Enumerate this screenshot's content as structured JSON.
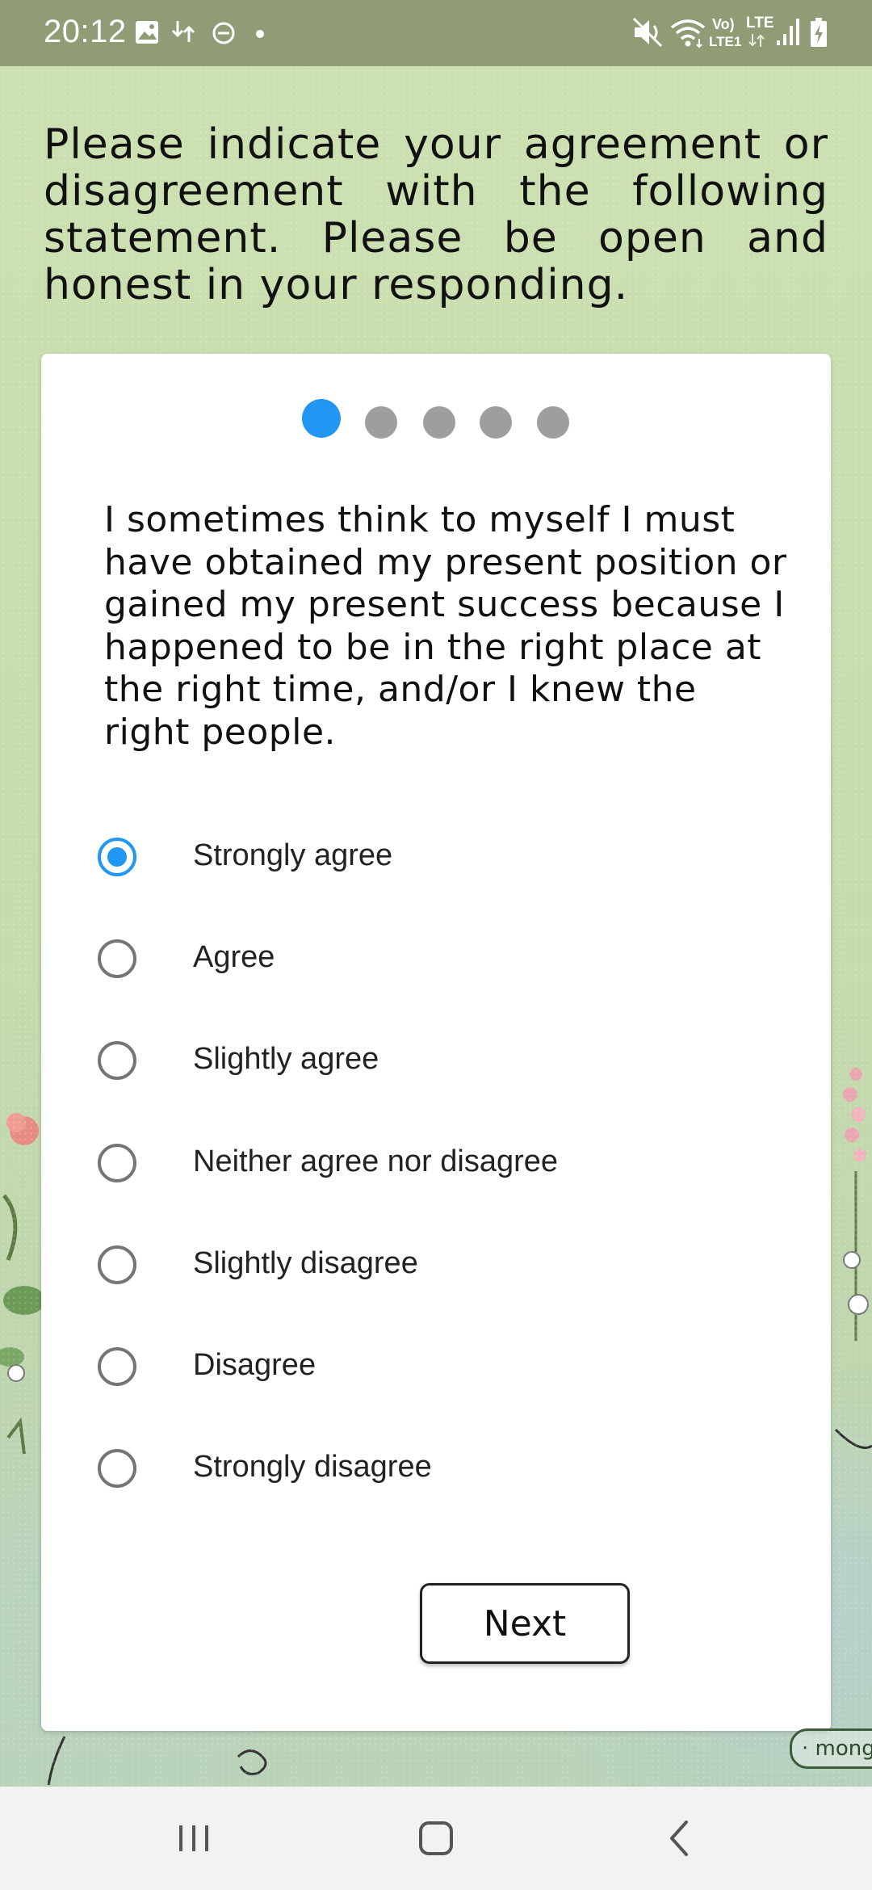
{
  "status_bar": {
    "time": "20:12",
    "left_icons": [
      "gallery-icon",
      "transfer-icon",
      "do-not-disturb-icon",
      "notification-dot-icon"
    ],
    "right_icons": [
      "mute-icon",
      "wifi-icon",
      "volte-lte1-icon",
      "lte-icon",
      "signal-icon",
      "battery-charging-icon"
    ],
    "volte_text": "Vo)",
    "lte1_text": "LTE1",
    "lte_text": "LTE"
  },
  "instruction": "Please indicate your agreement or disagreement with the following statement. Please be open and honest in your responding.",
  "progress": {
    "total_steps": 5,
    "current_step": 1
  },
  "statement": "I sometimes think to myself I must have obtained my present position or gained my present success because I happened to be in the right place at the right time, and/or I knew the right people.",
  "options": [
    {
      "label": "Strongly agree",
      "selected": true
    },
    {
      "label": "Agree",
      "selected": false
    },
    {
      "label": "Slightly agree",
      "selected": false
    },
    {
      "label": "Neither agree nor disagree",
      "selected": false
    },
    {
      "label": "Slightly disagree",
      "selected": false
    },
    {
      "label": "Disagree",
      "selected": false
    },
    {
      "label": "Strongly disagree",
      "selected": false
    }
  ],
  "next_button": "Next",
  "watermark": "· mongd",
  "nav_bar": {
    "icons": [
      "recent-apps-icon",
      "home-icon",
      "back-icon"
    ]
  },
  "colors": {
    "accent": "#2196f3",
    "inactive_dot": "#9e9e9e",
    "status_bar": "#8f9c75",
    "background": "#c9dcae"
  }
}
